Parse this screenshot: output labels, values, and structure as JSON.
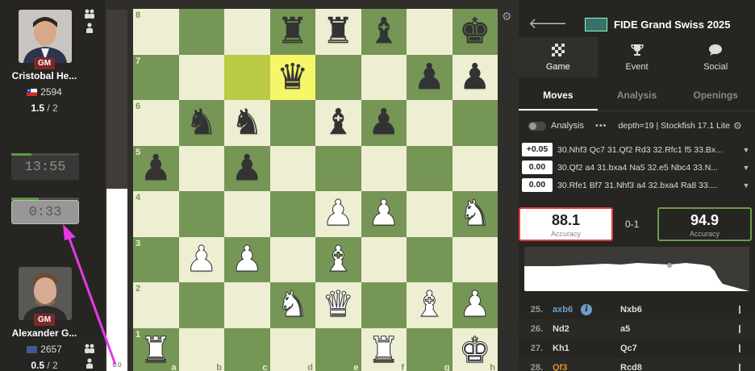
{
  "top_player": {
    "name": "Cristobal He...",
    "title": "GM",
    "rating": "2594",
    "score": "1.5",
    "score_total": " / 2",
    "clock": "13:55",
    "clock_fill": 0.3
  },
  "bottom_player": {
    "name": "Alexander G...",
    "title": "GM",
    "rating": "2657",
    "score": "0.5",
    "score_total": " / 2",
    "clock": "0:33",
    "clock_fill": 0.4
  },
  "eval_bar": {
    "value": "0.0",
    "white_fraction": 0.505
  },
  "board": {
    "files": [
      "a",
      "b",
      "c",
      "d",
      "e",
      "f",
      "g",
      "h"
    ],
    "ranks": [
      "8",
      "7",
      "6",
      "5",
      "4",
      "3",
      "2",
      "1"
    ],
    "highlight": [
      "c7",
      "d7"
    ],
    "pieces": {
      "d8": "bR",
      "e8": "bR",
      "f8": "bB",
      "h8": "bK",
      "d7": "bQ",
      "g7": "bP",
      "h7": "bP",
      "b6": "bN",
      "c6": "bN",
      "e6": "bB",
      "f6": "bP",
      "a5": "bP",
      "c5": "bP",
      "e4": "wP",
      "f4": "wP",
      "h4": "wN",
      "b3": "wP",
      "c3": "wP",
      "e3": "wB",
      "d2": "wN",
      "e2": "wQ",
      "g2": "wB",
      "h2": "wP",
      "a1": "wR",
      "f1": "wR",
      "h1": "wK"
    }
  },
  "panel": {
    "event_title": "FIDE Grand Swiss 2025",
    "tabs": [
      {
        "label": "Game",
        "icon": "board-icon"
      },
      {
        "label": "Event",
        "icon": "trophy-icon"
      },
      {
        "label": "Social",
        "icon": "chat-icon"
      }
    ],
    "subtabs": [
      "Moves",
      "Analysis",
      "Openings"
    ],
    "analysis_label": "Analysis",
    "engine": "depth=19 | Stockfish 17.1 Lite",
    "lines": [
      {
        "eval": "+0.05",
        "moves": "30.Nhf3 Qc7 31.Qf2 Rd3 32.Rfc1 f5 33.Bx..."
      },
      {
        "eval": "0.00",
        "moves": "30.Qf2 a4 31.bxa4 Na5 32.e5 Nbc4 33.N..."
      },
      {
        "eval": "0.00",
        "moves": "30.Rfe1 Bf7 31.Nhf3 a4 32.bxa4 Ra8 33...."
      }
    ],
    "accuracy_white": "88.1",
    "accuracy_black": "94.9",
    "accuracy_label": "Accuracy",
    "result": "0-1",
    "moves": [
      {
        "n": "25.",
        "w": "axb6",
        "b": "Nxb6",
        "book": true
      },
      {
        "n": "26.",
        "w": "Nd2",
        "b": "a5",
        "book": false
      },
      {
        "n": "27.",
        "w": "Kh1",
        "b": "Qc7",
        "book": false
      },
      {
        "n": "28.",
        "w": "Qf3",
        "b": "Rcd8",
        "book": false
      }
    ]
  },
  "colors": {
    "light_square": "#eeeed2",
    "dark_square": "#769656",
    "highlight_light": "#f6f669",
    "highlight_dark": "#baca44",
    "arrow": "#e838e8",
    "gm_badge": "#7c2929"
  }
}
